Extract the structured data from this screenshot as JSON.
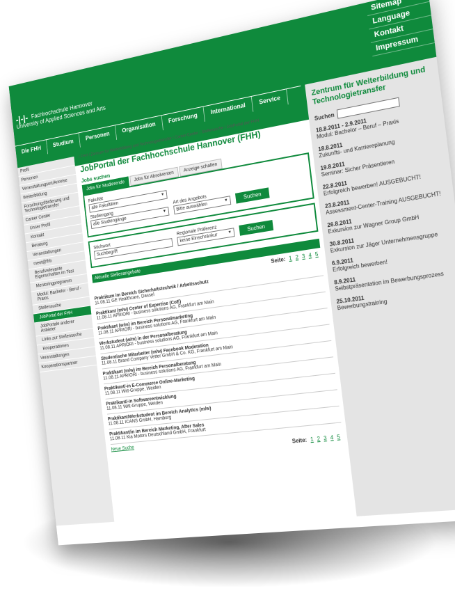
{
  "topnav": [
    "Sitemap",
    "Language",
    "Kontakt",
    "Impressum"
  ],
  "logo": {
    "mark": "-|-|-",
    "line1": "Fachhochschule Hannover",
    "line2": "University of Applied Sciences and Arts"
  },
  "mainnav": [
    "Die FHH",
    "Studium",
    "Personen",
    "Organisation",
    "Forschung",
    "International",
    "Service"
  ],
  "sidebar": [
    {
      "label": "Profil"
    },
    {
      "label": "Personen"
    },
    {
      "label": "Veranstaltungsort/Anreise"
    },
    {
      "label": "Weiterbildung"
    },
    {
      "label": "Forschungsförderung und Technologietransfer"
    },
    {
      "label": "Career Center"
    },
    {
      "label": "Unser Profil",
      "sub": true
    },
    {
      "label": "Kontakt",
      "sub": true
    },
    {
      "label": "Beratung",
      "sub": true
    },
    {
      "label": "Veranstaltungen",
      "sub": true
    },
    {
      "label": "meet@fhh",
      "sub": true
    },
    {
      "label": "Berufsrelevante Eigenschaften im Test",
      "sub": true
    },
    {
      "label": "Mentoringprogramm",
      "sub": true
    },
    {
      "label": "Modul: Bachelor - Beruf - Praxis",
      "sub": true
    },
    {
      "label": "Stellensuche",
      "sub": true
    },
    {
      "label": "JobPortal der FHH",
      "sub": true,
      "active": true
    },
    {
      "label": "JobPortale anderer Anbieter",
      "sub": true
    },
    {
      "label": "Links zur Stellensuche",
      "sub": true
    },
    {
      "label": "Kooperationen",
      "sub": true
    },
    {
      "label": "Veranstaltungen"
    },
    {
      "label": "Kooperationspartner"
    }
  ],
  "breadcrumb": "/ FHH / Zentrum für Weiterbildung und Technologietransfer / Career Center / Stellensuche / JobPortal der FHH",
  "page_title": "JobPortal der Fachhochschule Hannover (FHH)",
  "jobs_label": "Jobs suchen",
  "tabs": [
    "Jobs für Studierende",
    "Jobs für Absolventen",
    "Anzeige schalten"
  ],
  "form": {
    "fakultaet_label": "Fakultät",
    "fakultaet_value": "alle Fakultäten",
    "studiengang_label": "Studiengang",
    "studiengang_value": "alle Studiengänge",
    "angebot_label": "Art des Angebots",
    "angebot_value": "Bitte auswählen",
    "search_button": "Suchen",
    "stichwort_label": "Stichwort",
    "stichwort_value": "Suchbegriff",
    "region_label": "Regionale Präferenz",
    "region_value": "keine Einschränkur",
    "search_button2": "Suchen"
  },
  "offers_header": "Aktuelle Stellenangebote",
  "pager": {
    "label": "Seite:",
    "pages": [
      "1",
      "2",
      "3",
      "4",
      "5"
    ]
  },
  "offers": [
    {
      "title": "Praktikum im Bereich Sicherheitstechnik / Arbeitsschutz",
      "date": "11.08.11",
      "company": "GE Healthcare, Dassel"
    },
    {
      "title": "Praktikant (m/w) Center of Expertise (CoE)",
      "date": "11.08.11",
      "company": "APRIORI - business solutions AG, Frankfurt am Main"
    },
    {
      "title": "Praktikant (w/m) im Bereich Personalmarketing",
      "date": "11.08.11",
      "company": "APRIORI - business solutions AG, Frankfurt am Main"
    },
    {
      "title": "Werkstudent (w/m) in der Personalberatung",
      "date": "11.08.11",
      "company": "APRIORI - business solutions AG, Frankfurt am Main"
    },
    {
      "title": "Studentische Mitarbeiter (m/w) Facebook Moderation",
      "date": "11.08.11",
      "company": "Brand Company Vetter GmbH & Co. KG, Frankfurt am Main"
    },
    {
      "title": "Praktikant (m/w) im Bereich Personalberatung",
      "date": "11.08.11",
      "company": "APRIORI - business solutions AG, Frankfurt am Main"
    },
    {
      "title": "Praktikant/-in E-Commerce Online-Marketing",
      "date": "11.08.11",
      "company": "Witt-Gruppe, Weiden"
    },
    {
      "title": "Praktikant/-in Softwareentwicklung",
      "date": "11.08.11",
      "company": "Witt-Gruppe, Weiden"
    },
    {
      "title": "Praktikant/Werkstudent im Bereich Analytics (m/w)",
      "date": "11.08.11",
      "company": "ICANS GmbH, Hamburg"
    },
    {
      "title": "Praktikant/in im Bereich Marketing, After Sales",
      "date": "11.08.11",
      "company": "Kia Motors Deutschland GmbH, Frankfurt"
    }
  ],
  "new_search": "Neue Suche",
  "right": {
    "title": "Zentrum für Weiterbildung und Technologietransfer",
    "search_label": "Suchen",
    "events": [
      {
        "date": "18.8.2011 - 2.9.2011",
        "text": "Modul: Bachelor – Beruf – Praxis"
      },
      {
        "date": "18.8.2011",
        "text": "Zukunfts- und Karriereplanung"
      },
      {
        "date": "19.8.2011",
        "text": "Seminar: Sicher Präsentieren"
      },
      {
        "date": "22.8.2011",
        "text": "Erfolgreich bewerben! AUSGEBUCHT!"
      },
      {
        "date": "23.8.2011",
        "text": "Assessment-Center-Training AUSGEBUCHT!"
      },
      {
        "date": "26.8.2011",
        "text": "Exkursion zur Wagner Group GmbH"
      },
      {
        "date": "30.8.2011",
        "text": "Exkursion zur Jäger Unternehmensgruppe"
      },
      {
        "date": "6.9.2011",
        "text": "Erfolgreich bewerben!"
      },
      {
        "date": "8.9.2011",
        "text": "Selbstpräsentation im Bewerbungsprozess"
      },
      {
        "date": "25.10.2011",
        "text": "Bewerbungstraining"
      }
    ]
  }
}
